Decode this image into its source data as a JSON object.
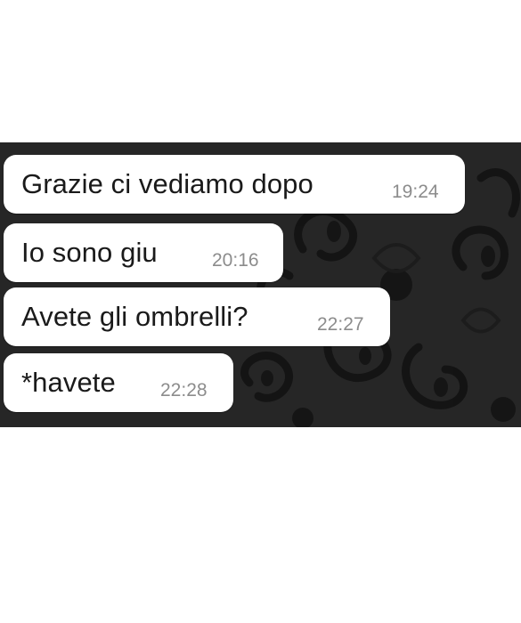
{
  "chat": {
    "messages": [
      {
        "text": "Grazie ci vediamo dopo",
        "time": "19:24"
      },
      {
        "text": "Io sono giu",
        "time": "20:16"
      },
      {
        "text": "Avete gli ombrelli?",
        "time": "22:27"
      },
      {
        "text": "*havete",
        "time": "22:28"
      }
    ],
    "colors": {
      "wallpaper": "#262626",
      "wallpaper_pattern": "#121212",
      "bubble": "#ffffff",
      "message_text": "#1a1a1a",
      "timestamp_text": "#8c8c8c",
      "page_background": "#ffffff"
    }
  }
}
